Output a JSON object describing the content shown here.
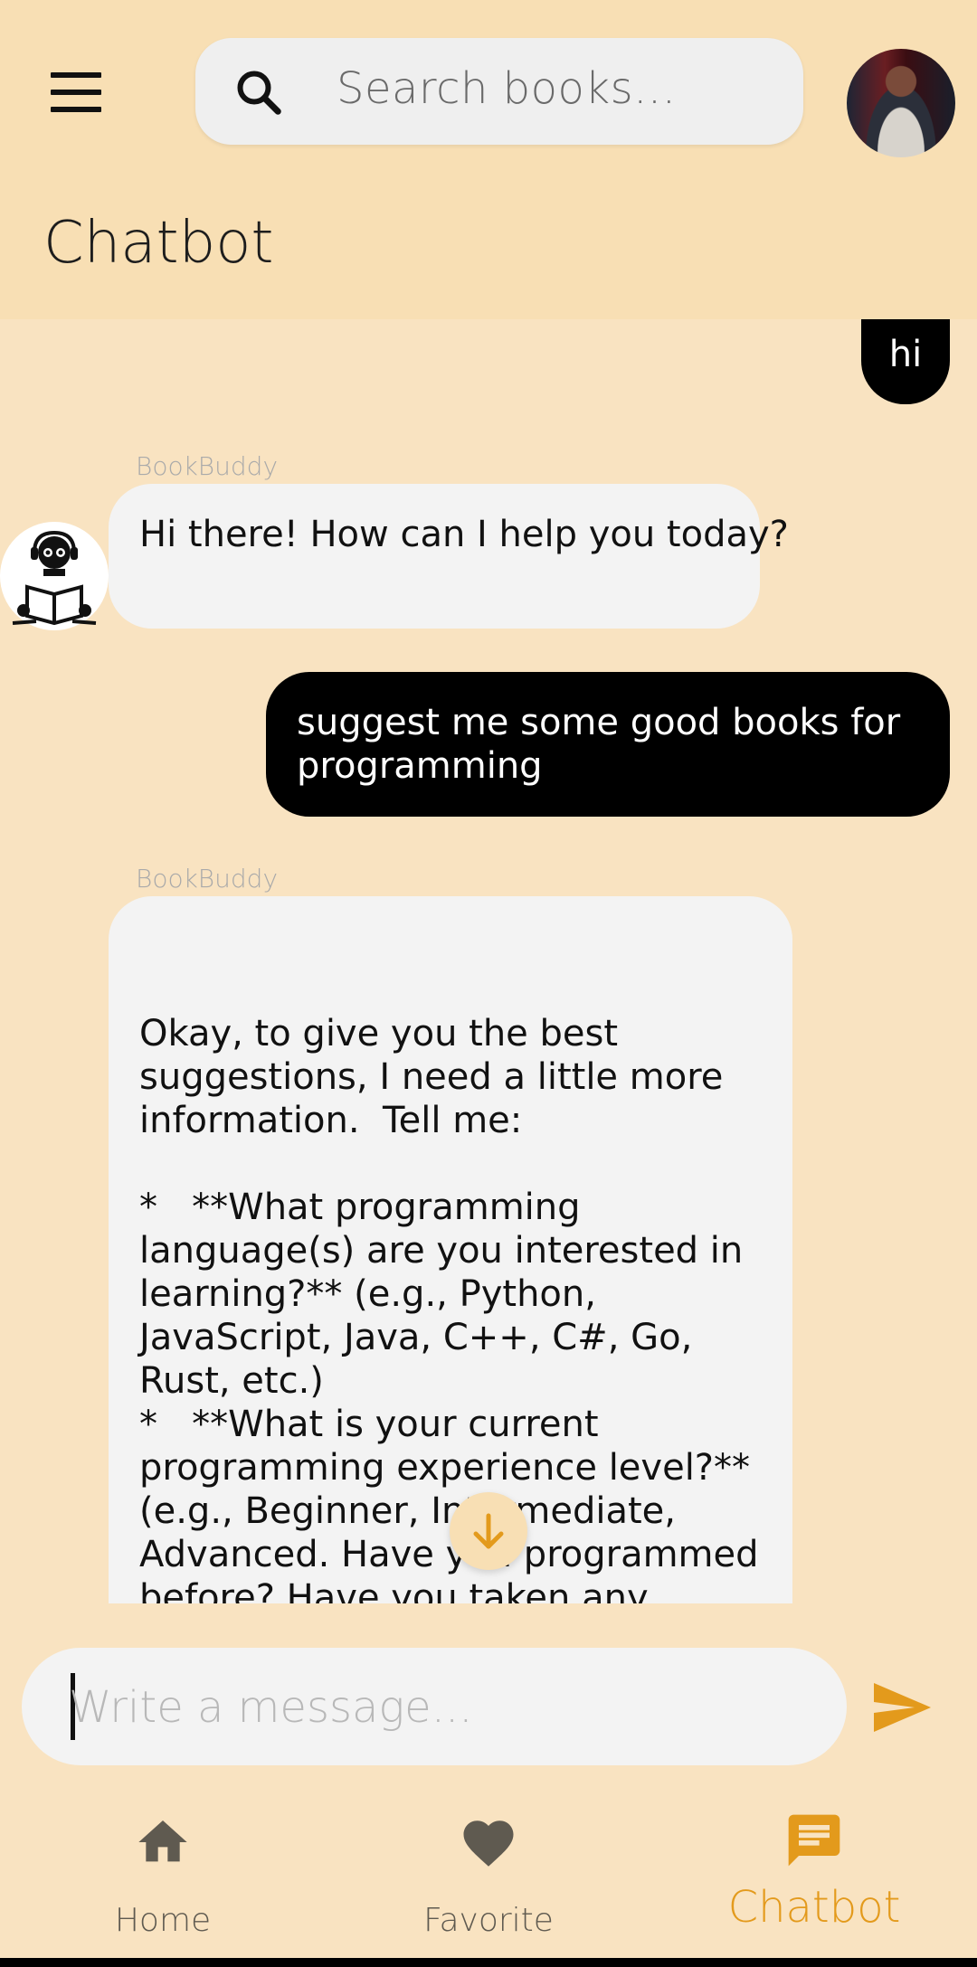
{
  "header": {
    "search_placeholder": "Search books...",
    "title": "Chatbot"
  },
  "messages": [
    {
      "role": "user",
      "text": "hi"
    },
    {
      "role": "bot",
      "sender": "BookBuddy",
      "text": "Hi there! How can I help you today?"
    },
    {
      "role": "user",
      "text": "suggest me some good books for programming"
    },
    {
      "role": "bot",
      "sender": "BookBuddy",
      "text": "Okay, to give you the best suggestions, I need a little more information.  Tell me:\n\n*   **What programming language(s) are you interested in learning?** (e.g., Python, JavaScript, Java, C++, C#, Go, Rust, etc.)\n*   **What is your current programming experience level?** (e.g., Beginner, Intermediate, Advanced. Have you programmed before? Have you taken any courses?)\n*   **What are you hoping to achieve with programming?** (e.g., Web"
    }
  ],
  "composer": {
    "placeholder": "Write a message..."
  },
  "nav": {
    "home": "Home",
    "favorite": "Favorite",
    "chatbot": "Chatbot"
  },
  "colors": {
    "header_bg": "#f8dfb4",
    "page_bg": "#f9e3c1",
    "accent": "#e39a1c",
    "user_bubble": "#000000",
    "bot_bubble": "#f3f3f3"
  }
}
